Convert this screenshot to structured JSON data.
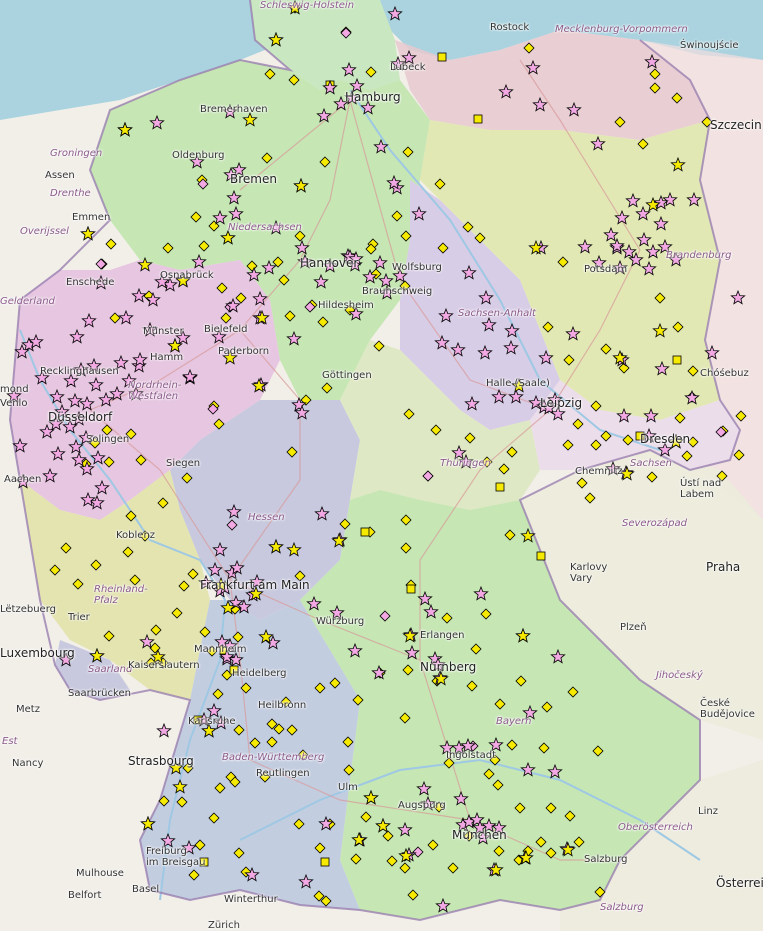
{
  "colors": {
    "sea": "#aad3df",
    "land": "#e9f0da",
    "de_green": "#c6e6b4",
    "de_pink": "#e6c6e0",
    "de_blue": "#c3cde0",
    "de_olive": "#e2e5a8",
    "de_purple": "#d8cde6",
    "cz": "#eeeedd",
    "pl": "#f2dede",
    "star_fill": "#f2a8e2",
    "diamond_fill": "#f5ea00",
    "square_fill": "#f5ea00",
    "outline": "#000000"
  },
  "icons": {
    "star": "star-icon",
    "diamond": "diamond-icon",
    "square": "square-icon"
  },
  "labels": {
    "schleswig_holstein": "Schleswig-Holstein",
    "rostock": "Rostock",
    "mecklenburg": "Mecklenburg-Vorpommern",
    "swinoujscie": "Świnoujście",
    "szczecin": "Szczecin",
    "hamburg": "Hamburg",
    "lubeck": "Lübeck",
    "bremerhaven": "Bremerhaven",
    "bremen": "Bremen",
    "oldenburg": "Oldenburg",
    "groningen": "Groningen",
    "assen": "Assen",
    "drenthe": "Drenthe",
    "emmen": "Emmen",
    "overijssel": "Overijssel",
    "enschede": "Enschede",
    "niedersachsen": "Niedersachsen",
    "osnabruck": "Osnabrück",
    "hannover": "Hannover",
    "wolfsburg": "Wolfsburg",
    "braunschweig": "Braunschweig",
    "hildesheim": "Hildesheim",
    "berlin_brand": "Brandenburg",
    "potsdam": "Potsdam",
    "gelderland": "Gelderland",
    "bielefeld": "Bielefeld",
    "paderborn": "Paderborn",
    "munster": "Münster",
    "hamm": "Hamm",
    "recklinghausen": "Recklinghausen",
    "nrw": "Nordrhein-Westfalen",
    "dusseldorf": "Düsseldorf",
    "venlo": "Venlo",
    "mond": "mond",
    "solingen": "Solingen",
    "aachen": "Aachen",
    "siegen": "Siegen",
    "gottingen": "Göttingen",
    "sachsen_anhalt": "Sachsen-Anhalt",
    "halle": "Halle (Saale)",
    "leipzig": "Leipzig",
    "thuringen": "Thüringen",
    "sachsen": "Sachsen",
    "dresden": "Dresden",
    "chemnitz": "Chemnitz",
    "chosebuz": "Chóśebuz",
    "usti": "Ústí nad Labem",
    "severozapad": "Severozápad",
    "hessen": "Hessen",
    "koblenz": "Koblenz",
    "rheinland": "Rheinland-Pfalz",
    "frankfurt": "Frankfurt am Main",
    "wurzburg": "Würzburg",
    "karlovy": "Karlovy Vary",
    "praha": "Praha",
    "luxembourg": "Luxembourg",
    "lutzebuerg": "Lëtzebuerg",
    "trier": "Trier",
    "mannheim": "Mannheim",
    "heidelberg": "Heidelberg",
    "erlangen": "Erlangen",
    "nurnberg": "Nürnberg",
    "plzen": "Plzeň",
    "saarland": "Saarland",
    "kaiserslautern": "Kaiserslautern",
    "saarbrucken": "Saarbrücken",
    "metz": "Metz",
    "heilbronn": "Heilbronn",
    "jihocesky": "Jihočeský",
    "karlsruhe": "Karlsruhe",
    "bayern": "Bayern",
    "ingolstadt": "Ingolstadt",
    "ceske": "České Budějovice",
    "nancy": "Nancy",
    "est": "Est",
    "strasbourg": "Strasbourg",
    "bw": "Baden-Württemberg",
    "reutlingen": "Reutlingen",
    "ulm": "Ulm",
    "augsburg": "Augsburg",
    "munchen": "München",
    "linz": "Linz",
    "oberosterreich": "Oberösterreich",
    "freiburg": "Freiburg\nim Breisgau",
    "mulhouse": "Mulhouse",
    "salzburg": "Salzburg",
    "salzburg_region": "Salzburg",
    "basel": "Basel",
    "belfort": "Belfort",
    "winterthur": "Winterthur",
    "osterreich": "Österrei",
    "zurich": "Zürich"
  }
}
